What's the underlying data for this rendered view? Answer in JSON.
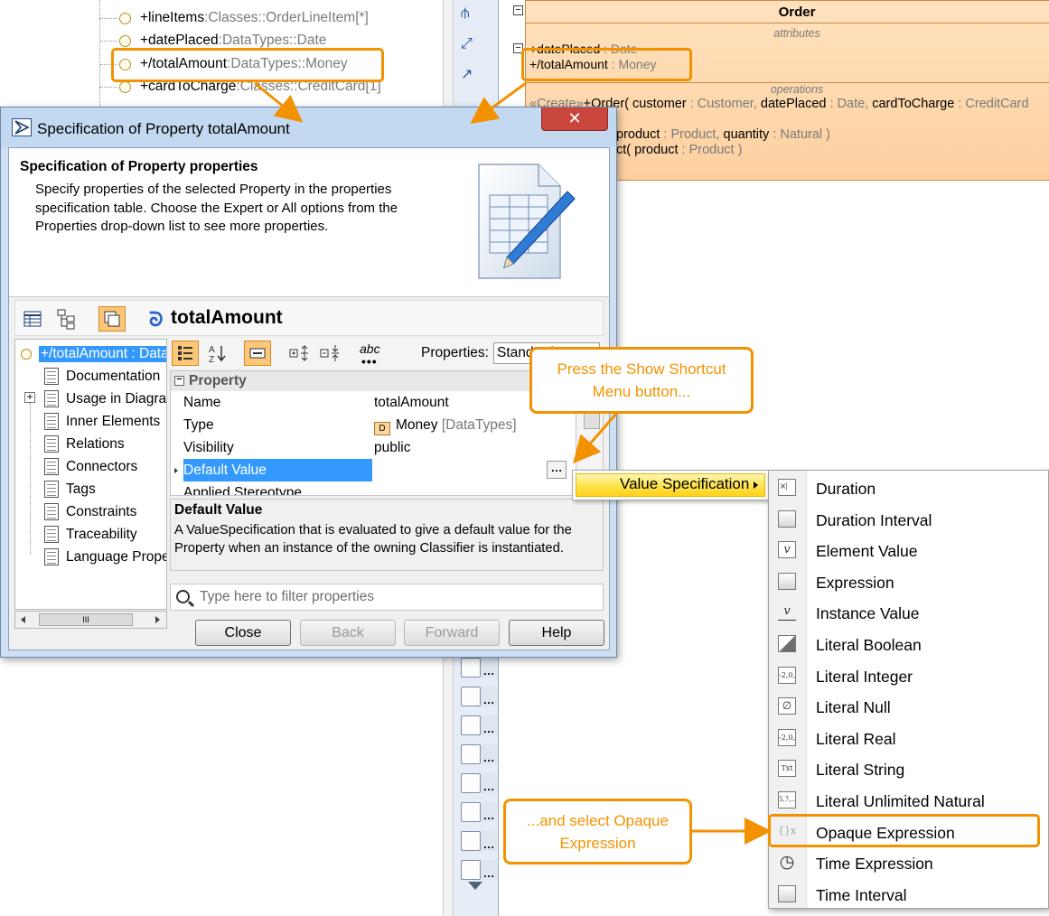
{
  "background_tree": {
    "rows": [
      {
        "name": "+lineItems",
        "sep": " : ",
        "type": "Classes::OrderLineItem",
        "mult": " [*]"
      },
      {
        "name": "+datePlaced",
        "sep": " : ",
        "type": "DataTypes::Date",
        "mult": ""
      },
      {
        "name": "+/totalAmount",
        "sep": " : ",
        "type": "DataTypes::Money",
        "mult": ""
      },
      {
        "name": "+cardToCharge",
        "sep": " : ",
        "type": "Classes::CreditCard",
        "mult": " [1]"
      }
    ]
  },
  "diagram": {
    "class_name": "Order",
    "attributes_label": "attributes",
    "operations_label": "operations",
    "attributes": [
      {
        "name": "+datePlaced",
        "sep": " : ",
        "type": "Date"
      },
      {
        "name": "+/totalAmount",
        "sep": " : ",
        "type": "Money"
      }
    ],
    "operations": [
      {
        "stereo": "«Create»",
        "text": "+Order( customer",
        "sep1": " : Customer, ",
        "p2": "datePlaced",
        "sep2": " : Date, ",
        "p3": "cardToCharge",
        "sep3": " : CreditCard"
      },
      {
        "text": "product",
        "rest": " : Product, ",
        "p2": "quantity",
        "rest2": " : Natural )"
      },
      {
        "text": "ct( product",
        "rest": " : Product )"
      }
    ]
  },
  "dialog": {
    "title": "Specification of Property totalAmount",
    "close_glyph": "✕",
    "header_title": "Specification of Property properties",
    "header_description": "Specify properties of the selected Property in the properties specification table. Choose the Expert or All options from the Properties drop-down list to see more properties.",
    "element_name": "totalAmount",
    "nav_items": [
      {
        "label": "+/totalAmount : DataTypes::Money",
        "selected": true
      },
      {
        "label": "Documentation"
      },
      {
        "label": "Usage in Diagrams"
      },
      {
        "label": "Inner Elements"
      },
      {
        "label": "Relations"
      },
      {
        "label": "Connectors"
      },
      {
        "label": "Tags"
      },
      {
        "label": "Constraints"
      },
      {
        "label": "Traceability"
      },
      {
        "label": "Language Properties"
      }
    ],
    "properties_filter_label": "Properties:",
    "properties_filter_value": "Standard",
    "abc_label": "abc",
    "group_label": "Property",
    "properties": [
      {
        "key": "Name",
        "value": "totalAmount"
      },
      {
        "key": "Type",
        "value": "Money",
        "extra": " [DataTypes]"
      },
      {
        "key": "Visibility",
        "value": "public"
      },
      {
        "key": "Default Value",
        "value": "",
        "selected": true
      },
      {
        "key": "Applied Stereotype",
        "value": ""
      }
    ],
    "description_title": "Default Value",
    "description_text": "A ValueSpecification that is evaluated to give a default value for the Property when an instance of the owning Classifier is instantiated.",
    "filter_placeholder": "Type here to filter properties",
    "buttons": {
      "close": "Close",
      "back": "Back",
      "forward": "Forward",
      "help": "Help"
    }
  },
  "menu": {
    "value_specification": "Value Specification",
    "items": [
      {
        "label": "Duration",
        "icon": "×⎸"
      },
      {
        "label": "Duration Interval",
        "icon": ""
      },
      {
        "label": "Element Value",
        "icon": "v"
      },
      {
        "label": "Expression",
        "icon": ""
      },
      {
        "label": "Instance Value",
        "icon": "v"
      },
      {
        "label": "Literal Boolean",
        "icon": ""
      },
      {
        "label": "Literal Integer",
        "icon": "-2,0,"
      },
      {
        "label": "Literal Null",
        "icon": "∅"
      },
      {
        "label": "Literal Real",
        "icon": "-2,0,"
      },
      {
        "label": "Literal String",
        "icon": "Txt"
      },
      {
        "label": "Literal Unlimited Natural",
        "icon": "5,7,.."
      },
      {
        "label": "Opaque Expression",
        "icon": "{}xy"
      },
      {
        "label": "Time Expression",
        "icon": "◷"
      },
      {
        "label": "Time Interval",
        "icon": ""
      }
    ]
  },
  "callouts": {
    "shortcut": "Press the Show Shortcut Menu button...",
    "select": "...and select Opaque Expression"
  },
  "colors": {
    "accent": "#f39200",
    "selection": "#3399ff",
    "class_fill": "#fdd0a0"
  }
}
